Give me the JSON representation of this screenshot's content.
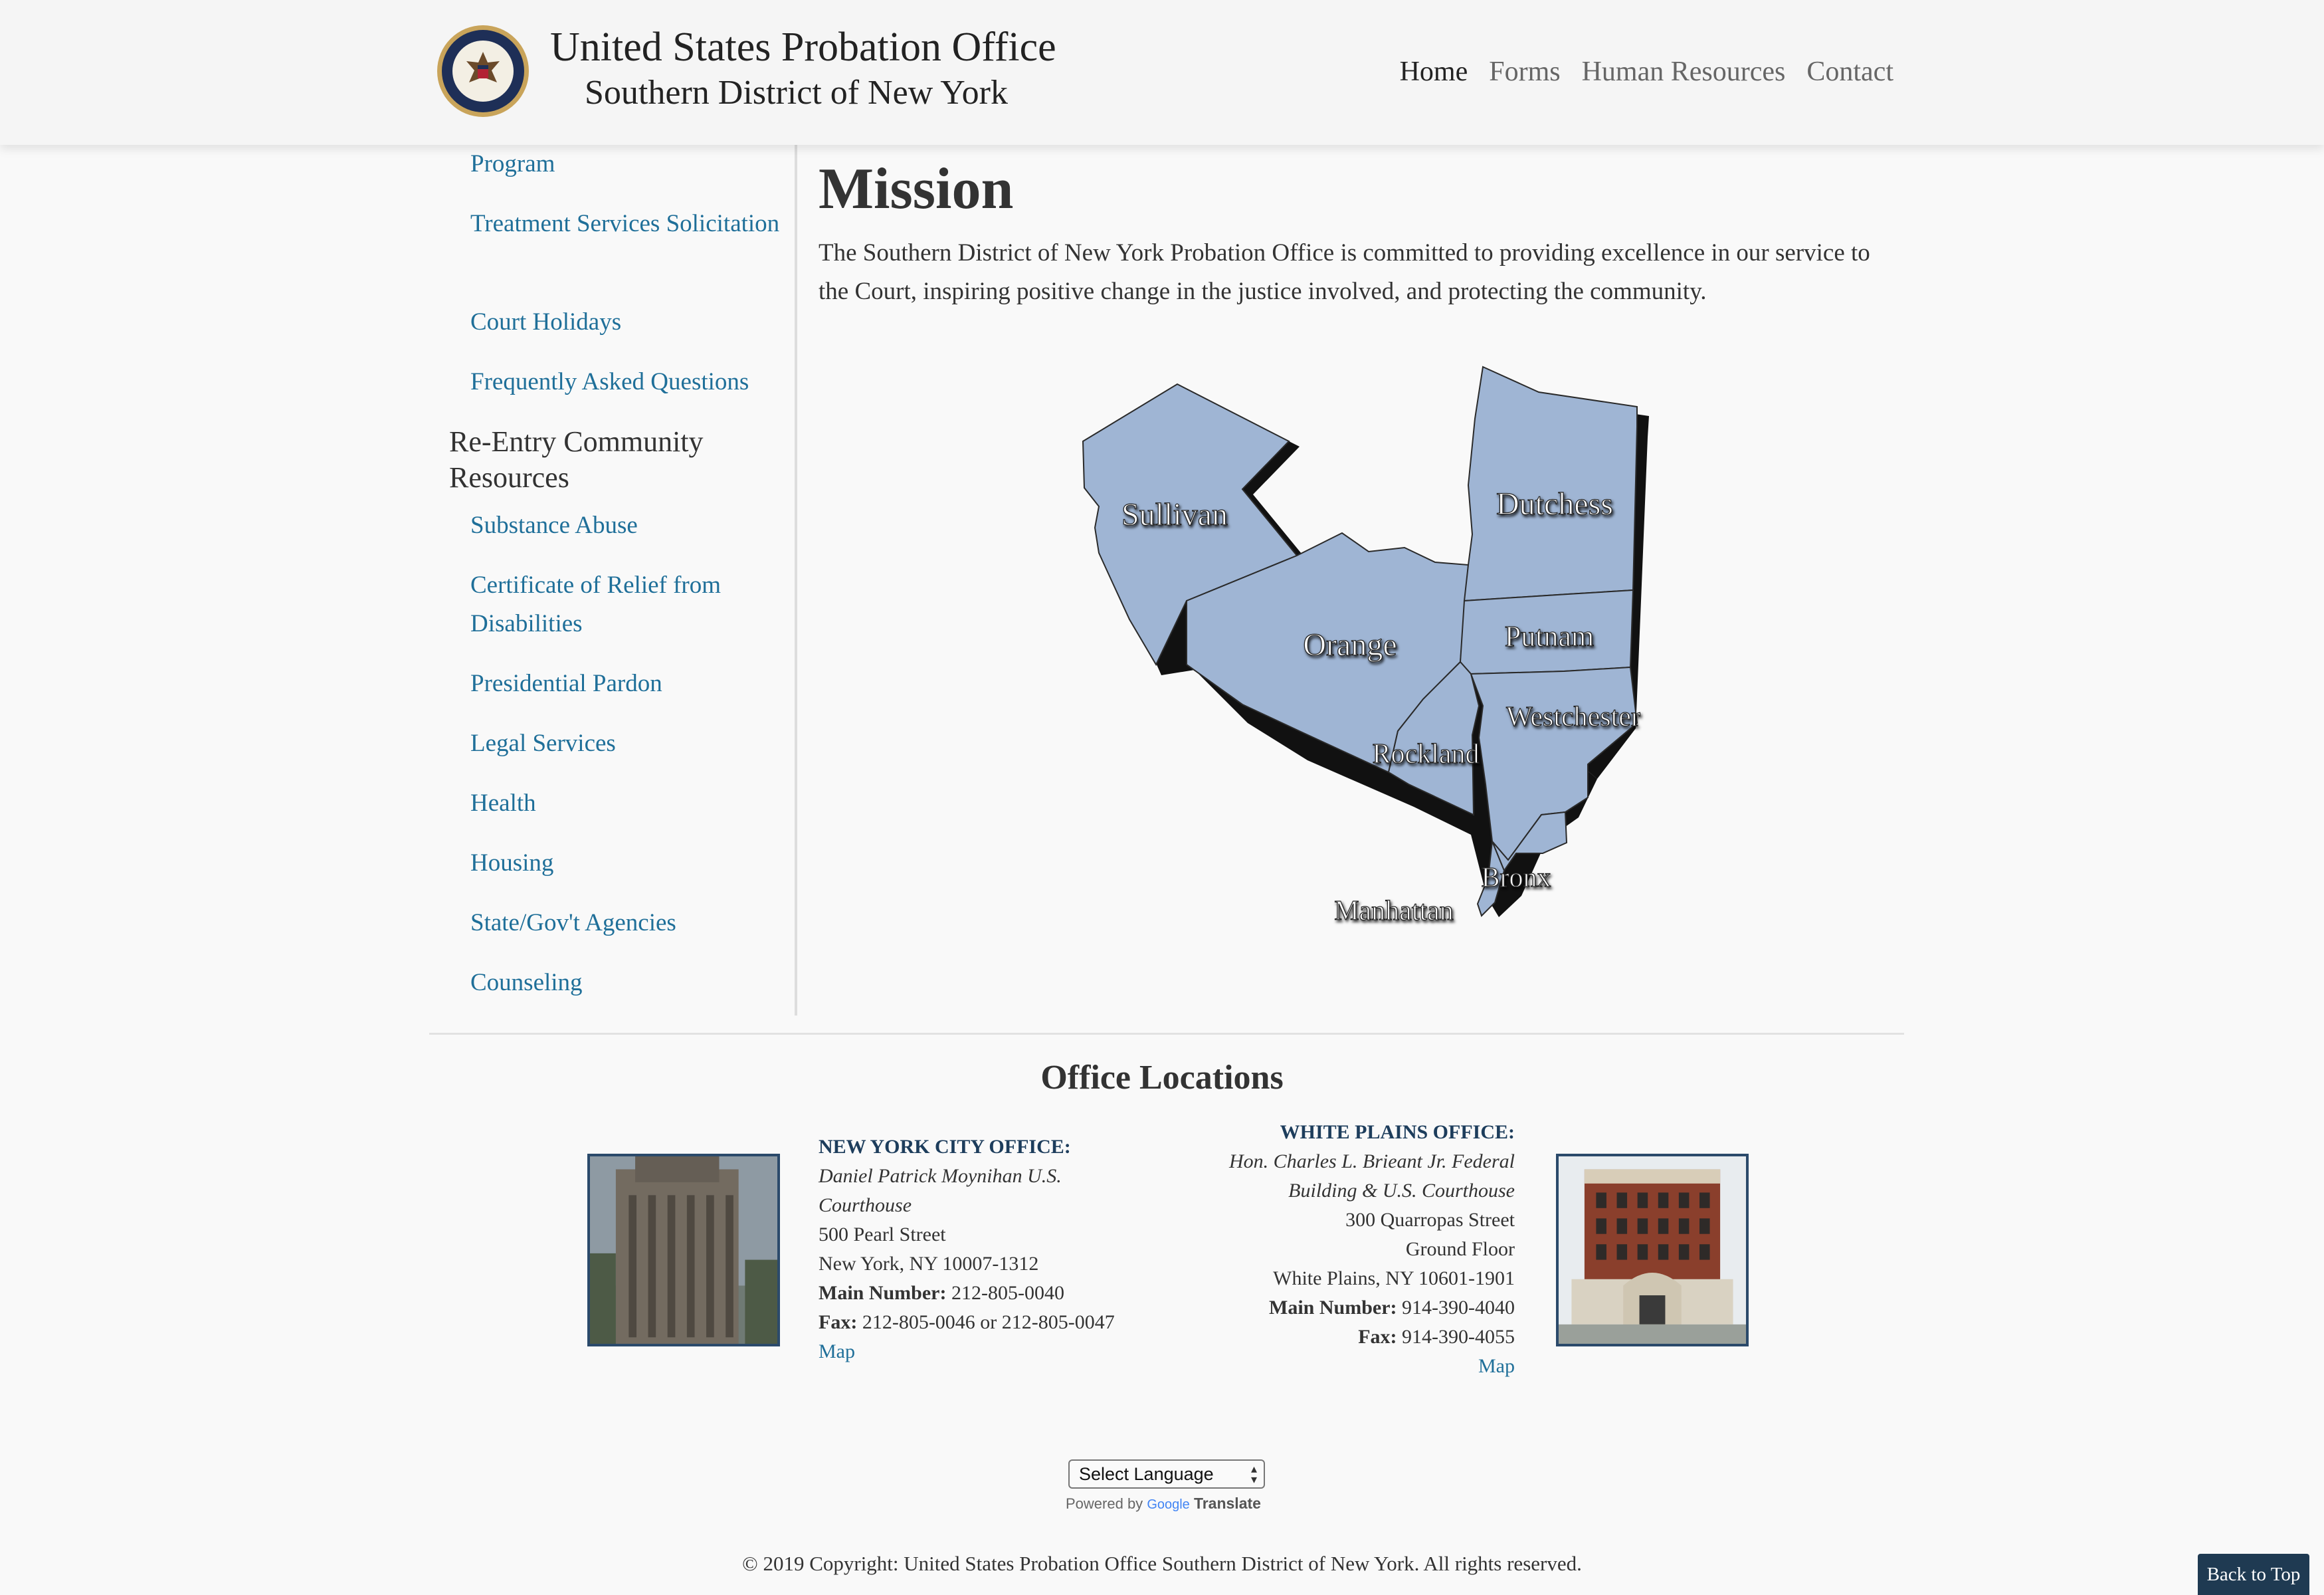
{
  "header": {
    "title": "United States Probation Office",
    "subtitle": "Southern District of New York",
    "nav": [
      "Home",
      "Forms",
      "Human Resources",
      "Contact"
    ]
  },
  "sidebar": {
    "links_top": [
      "Program",
      "Treatment Services Solicitation",
      "Court Holidays",
      "Frequently Asked Questions"
    ],
    "heading": "Re-Entry Community Resources",
    "links": [
      "Substance Abuse",
      "Certificate of Relief from Disabilities",
      "Presidential Pardon",
      "Legal Services",
      "Health",
      "Housing",
      "State/Gov't Agencies",
      "Counseling"
    ]
  },
  "main": {
    "title": "Mission",
    "text": "The Southern District of New York Probation Office is committed to providing excellence in our service to the Court, inspiring positive change in the justice involved, and protecting the community."
  },
  "map": {
    "counties": [
      "Sullivan",
      "Dutchess",
      "Orange",
      "Putnam",
      "Westchester",
      "Rockland",
      "Bronx",
      "Manhattan"
    ],
    "fill_color": "#9fb5d4"
  },
  "locations": {
    "title": "Office Locations",
    "nyc": {
      "name": "NEW YORK CITY OFFICE:",
      "building": "Daniel Patrick Moynihan U.S. Courthouse",
      "street": "500 Pearl Street",
      "city": "New York, NY 10007-1312",
      "main_label": "Main Number:",
      "main_value": "212-805-0040",
      "fax_label": "Fax:",
      "fax_value": "212-805-0046 or 212-805-0047",
      "map_link": "Map"
    },
    "wp": {
      "name": "WHITE PLAINS OFFICE:",
      "building": "Hon. Charles L. Brieant Jr. Federal Building & U.S. Courthouse",
      "street": "300 Quarropas Street",
      "floor": "Ground Floor",
      "city": "White Plains, NY 10601-1901",
      "main_label": "Main Number:",
      "main_value": "914-390-4040",
      "fax_label": "Fax:",
      "fax_value": "914-390-4055",
      "map_link": "Map"
    }
  },
  "footer": {
    "language_select": "Select Language",
    "powered_by": "Powered by",
    "google": "Google",
    "translate": "Translate",
    "copyright": "© 2019 Copyright: United States Probation Office Southern District of New York. All rights reserved.",
    "back_to_top": "Back to Top"
  },
  "colors": {
    "link": "#1f6f99",
    "header_bg": "#f5f5f5",
    "office_name": "#1d3d5c",
    "back_to_top_bg": "#1f3a52"
  }
}
